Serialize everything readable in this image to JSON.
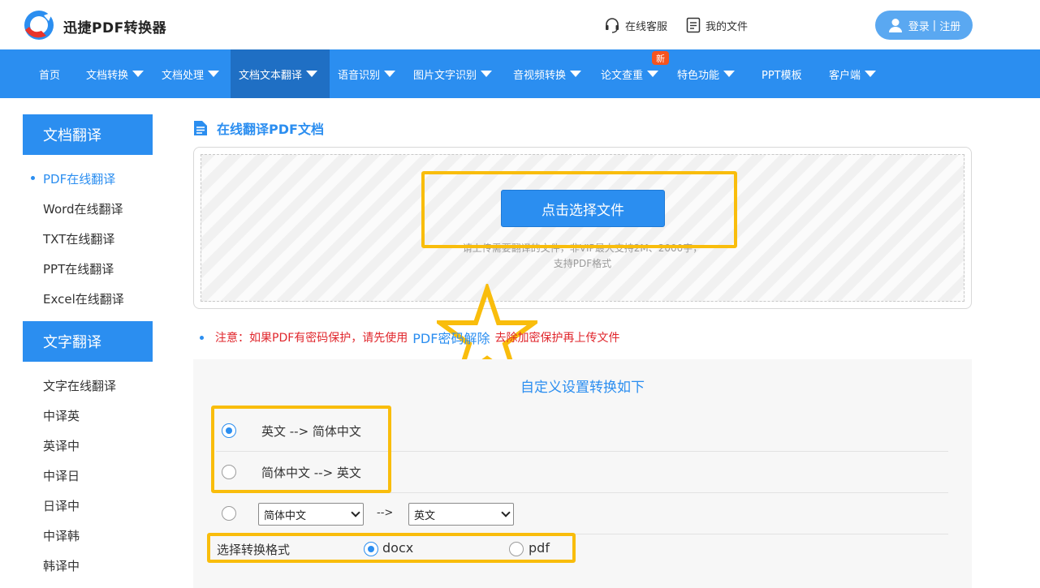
{
  "header": {
    "brand": "迅捷PDF转换器",
    "service_label": "在线客服",
    "files_label": "我的文件",
    "login_label": "登录",
    "register_label": "注册",
    "login_sep": "|"
  },
  "nav": {
    "items": [
      {
        "label": "首页",
        "has_caret": false
      },
      {
        "label": "文档转换",
        "has_caret": true
      },
      {
        "label": "文档处理",
        "has_caret": true
      },
      {
        "label": "文档文本翻译",
        "has_caret": true,
        "active": true
      },
      {
        "label": "语音识别",
        "has_caret": true
      },
      {
        "label": "图片文字识别",
        "has_caret": true
      },
      {
        "label": "音视频转换",
        "has_caret": true
      },
      {
        "label": "论文查重",
        "has_caret": true
      },
      {
        "label": "特色功能",
        "has_caret": true
      },
      {
        "label": "PPT模板",
        "has_caret": false
      },
      {
        "label": "客户端",
        "has_caret": true
      }
    ],
    "new_badge": "新"
  },
  "sidebar": {
    "doc_section_title": "文档翻译",
    "doc_items": [
      "PDF在线翻译",
      "Word在线翻译",
      "TXT在线翻译",
      "PPT在线翻译",
      "Excel在线翻译"
    ],
    "text_section_title": "文字翻译",
    "text_items": [
      "文字在线翻译",
      "中译英",
      "英译中",
      "中译日",
      "日译中",
      "中译韩",
      "韩译中"
    ]
  },
  "main": {
    "title": "在线翻译PDF文档",
    "choose_button": "点击选择文件",
    "upload_hint_line1": "请上传需要翻译的文件，非VIP最大支持2M、2000字，",
    "upload_hint_line2": "支持PDF格式",
    "notice_prefix": "注意：如果PDF有密码保护，请先使用",
    "notice_link": "PDF密码解除",
    "notice_suffix": "去除加密保护再上传文件",
    "settings_title": "自定义设置转换如下",
    "option1": "英文 --> 简体中文",
    "option2": "简体中文 --> 英文",
    "custom_from": "简体中文",
    "custom_arrow": "-->",
    "custom_to": "英文",
    "format_label": "选择转换格式",
    "format_docx": "docx",
    "format_pdf": "pdf"
  },
  "colors": {
    "accent": "#2b8ef0",
    "highlight": "#f9bd0c",
    "notice": "#e0262c",
    "badge": "#f5541f"
  }
}
